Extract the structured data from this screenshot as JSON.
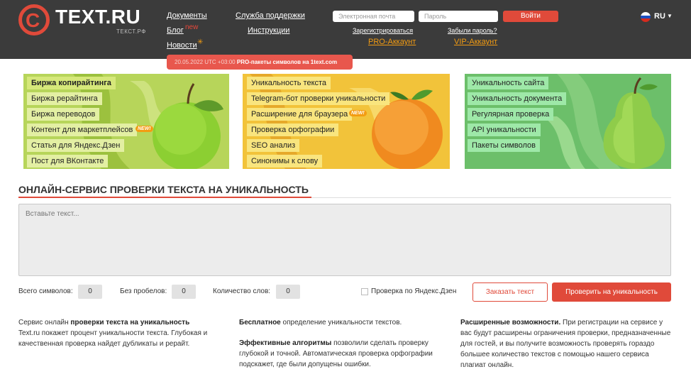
{
  "header": {
    "logo_text": "TEXT.RU",
    "logo_sub": "ТЕКСТ.РФ",
    "nav": {
      "documents": "Документы",
      "blog": "Блог",
      "blog_badge": "new",
      "news": "Новости",
      "support": "Служба поддержки",
      "instructions": "Инструкции"
    },
    "auth": {
      "email_placeholder": "Электронная почта",
      "password_placeholder": "Пароль",
      "login": "Войти",
      "register": "Зарегистрироваться",
      "forgot": "Забыли пароль?",
      "pro": "PRO-Аккаунт",
      "vip": "VIP-Аккаунт"
    },
    "lang": "RU"
  },
  "promo": {
    "date": "20.05.2022 UTC +03:00",
    "text": "PRO-пакеты символов на 1text.com"
  },
  "banners": {
    "left": [
      "Биржа копирайтинга",
      "Биржа рерайтинга",
      "Биржа переводов",
      "Контент для маркетплейсов",
      "Статья для Яндекс.Дзен",
      "Пост для ВКонтакте"
    ],
    "middle": [
      "Уникальность текста",
      "Telegram-бот проверки уникальности",
      "Расширение для браузера",
      "Проверка орфографии",
      "SEO анализ",
      "Синонимы к слову"
    ],
    "right": [
      "Уникальность сайта",
      "Уникальность документа",
      "Регулярная проверка",
      "API уникальности",
      "Пакеты символов"
    ],
    "new_badge": "NEW!"
  },
  "main": {
    "title": "ОНЛАЙН-СЕРВИС ПРОВЕРКИ ТЕКСТА НА УНИКАЛЬНОСТЬ",
    "placeholder": "Вставьте текст...",
    "total_label": "Всего символов:",
    "total_value": "0",
    "nospace_label": "Без пробелов:",
    "nospace_value": "0",
    "words_label": "Количество слов:",
    "words_value": "0",
    "yandex_check": "Проверка по Яндекс.Дзен",
    "order_btn": "Заказать текст",
    "check_btn": "Проверить на уникальность"
  },
  "info": {
    "col1_a": "Сервис онлайн ",
    "col1_b": "проверки текста на уникальность",
    "col1_c": "Text.ru покажет процент уникальности текста. Глубокая и качественная проверка найдет дубликаты и рерайт.",
    "col2_a_b": "Бесплатное",
    "col2_a": " определение уникальности текстов.",
    "col2_b_b": "Эффективные алгоритмы",
    "col2_b": " позволили сделать проверку глубокой и точной. Автоматическая проверка орфографии подскажет, где были допущены ошибки.",
    "col3_b": "Расширенные возможности.",
    "col3": " При регистрации на сервисе у вас будут расширены ограничения проверки, предназначенные для гостей, и вы получите возможность проверять гораздо большее количество текстов с помощью нашего сервиса плагиат онлайн."
  }
}
